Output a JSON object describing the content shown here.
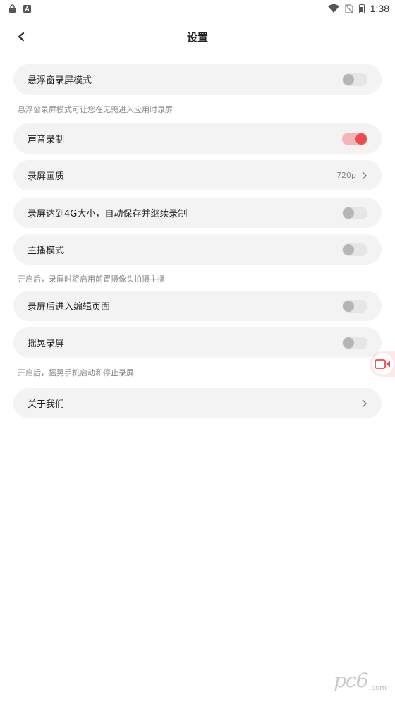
{
  "status_bar": {
    "time": "1:38",
    "left_icons": [
      "lock-icon",
      "a-icon"
    ],
    "right_icons": [
      "wifi-icon",
      "no-sim-icon",
      "battery-icon"
    ]
  },
  "header": {
    "title": "设置",
    "back_icon": "back-arrow-icon"
  },
  "settings": {
    "floating_window": {
      "label": "悬浮窗录屏模式",
      "enabled": false,
      "hint": "悬浮窗录屏模式可让您在无需进入应用时录屏"
    },
    "audio_record": {
      "label": "声音录制",
      "enabled": true
    },
    "quality": {
      "label": "录屏画质",
      "value": "720p"
    },
    "auto_save_4g": {
      "label": "录屏达到4G大小，自动保存并继续录制",
      "enabled": false
    },
    "anchor_mode": {
      "label": "主播模式",
      "enabled": false,
      "hint": "开启后，录屏时将启用前置摄像头拍摄主播"
    },
    "edit_after": {
      "label": "录屏后进入编辑页面",
      "enabled": false
    },
    "shake_record": {
      "label": "摇晃录屏",
      "enabled": false,
      "hint": "开启后，摇晃手机启动和停止录屏"
    },
    "about": {
      "label": "关于我们"
    }
  },
  "colors": {
    "accent": "#ec4c4c",
    "row_bg": "#f3f3f3",
    "toggle_off": "#e6e6e6"
  },
  "watermark": {
    "text": "pc6",
    "small": ".com"
  }
}
